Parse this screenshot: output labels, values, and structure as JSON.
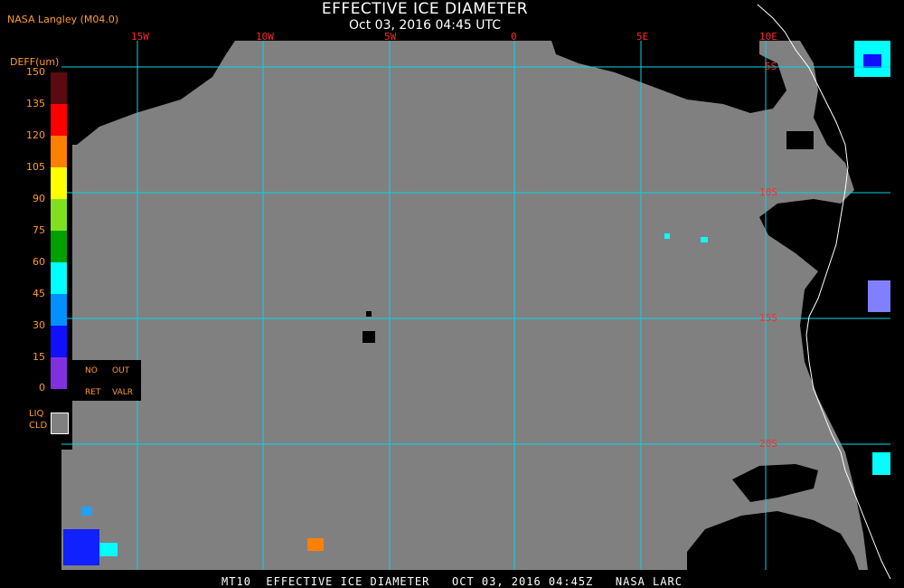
{
  "header": {
    "title": "EFFECTIVE ICE DIAMETER",
    "datetime": "Oct 03, 2016 04:45 UTC",
    "source": "NASA Langley (M04.0)"
  },
  "map": {
    "lon_labels": [
      "15W",
      "10W",
      "5W",
      "0",
      "5E",
      "10E"
    ],
    "lat_labels": [
      "5S",
      "10S",
      "15S",
      "20S"
    ],
    "colors": {
      "background_value": "#808080",
      "grid": "#00d8e8",
      "coast": "#ffffff",
      "no_data": "#000000"
    }
  },
  "legend": {
    "unit": "DEFF(um)",
    "ticks": [
      "150",
      "135",
      "120",
      "105",
      "90",
      "75",
      "60",
      "45",
      "30",
      "15",
      "0"
    ],
    "colors": [
      "#5a0a10",
      "#ff0000",
      "#ff8000",
      "#ffff00",
      "#80e020",
      "#00a000",
      "#00ffff",
      "#0090ff",
      "#1010ff",
      "#8030e0"
    ],
    "no_ret": [
      "NO",
      "RET"
    ],
    "out_valr": [
      "OUT",
      "VALR"
    ],
    "liq_cld": [
      "LIQ",
      "CLD"
    ]
  },
  "footer": "MT10  EFFECTIVE ICE DIAMETER   OCT 03, 2016 04:45Z   NASA LARC"
}
